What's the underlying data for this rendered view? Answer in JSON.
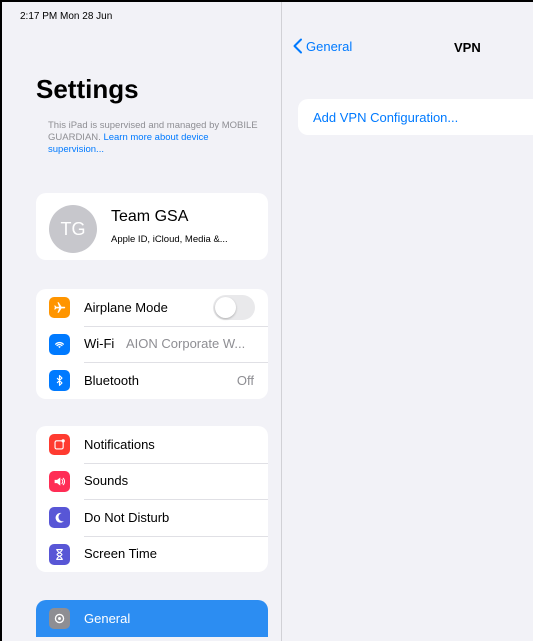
{
  "status_bar": {
    "time_date": "2:17 PM  Mon 28 Jun"
  },
  "sidebar": {
    "title": "Settings",
    "supervision_text": "This iPad is supervised and managed by MOBILE GUARDIAN.",
    "supervision_link": "Learn more about device supervision...",
    "profile": {
      "initials": "TG",
      "name": "Team GSA",
      "subtitle": "Apple ID, iCloud, Media &..."
    },
    "group1": [
      {
        "label": "Airplane Mode",
        "icon": "airplane-icon",
        "color": "#ff9500",
        "toggle": "off"
      },
      {
        "label": "Wi-Fi",
        "value": "AION Corporate W...",
        "icon": "wifi-icon",
        "color": "#007aff"
      },
      {
        "label": "Bluetooth",
        "value": "Off",
        "icon": "bluetooth-icon",
        "color": "#007aff"
      }
    ],
    "group2": [
      {
        "label": "Notifications",
        "icon": "notifications-icon",
        "color": "#ff3b30"
      },
      {
        "label": "Sounds",
        "icon": "speaker-icon",
        "color": "#ff2d55"
      },
      {
        "label": "Do Not Disturb",
        "icon": "moon-icon",
        "color": "#5856d6"
      },
      {
        "label": "Screen Time",
        "icon": "hourglass-icon",
        "color": "#5856d6"
      }
    ],
    "group3": [
      {
        "label": "General",
        "icon": "gear-icon",
        "color": "#8e8e93",
        "selected": true
      }
    ]
  },
  "detail": {
    "back_label": "General",
    "title": "VPN",
    "add_vpn_label": "Add VPN Configuration..."
  }
}
